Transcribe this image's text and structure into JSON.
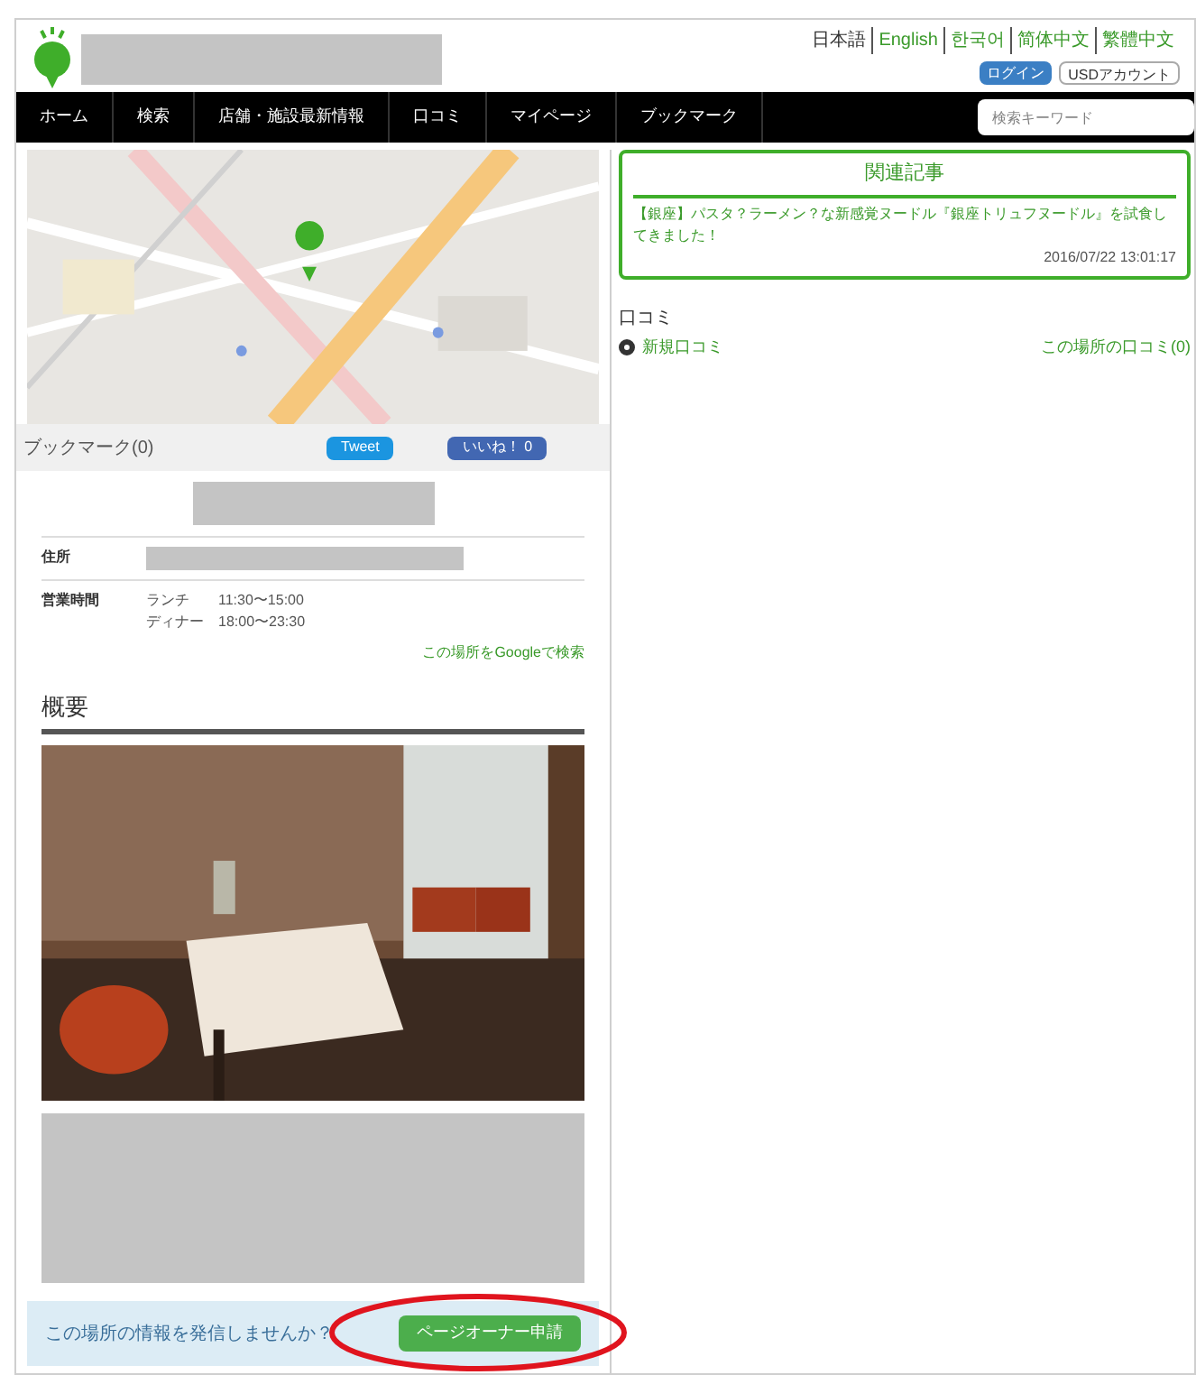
{
  "languages": [
    {
      "label": "日本語",
      "selected": true
    },
    {
      "label": "English",
      "selected": false
    },
    {
      "label": "한국어",
      "selected": false
    },
    {
      "label": "简体中文",
      "selected": false
    },
    {
      "label": "繁體中文",
      "selected": false
    }
  ],
  "account_buttons": [
    {
      "label": "ログイン",
      "kind": "primary"
    },
    {
      "label": "USDアカウント",
      "kind": "plain"
    }
  ],
  "nav": [
    "ホーム",
    "検索",
    "店舗・施設最新情報",
    "口コミ",
    "マイページ",
    "ブックマーク"
  ],
  "search": {
    "placeholder": "検索キーワード"
  },
  "bookmark": "ブックマーク(0)",
  "tweet_button": "Tweet",
  "like_button": "いいね！ 0",
  "info_rows": [
    {
      "label": "住所",
      "kind": "redacted"
    },
    {
      "label": "営業時間",
      "kind": "hours",
      "lines": [
        {
          "name": "ランチ",
          "time": "11:30〜15:00"
        },
        {
          "name": "ディナー",
          "time": "18:00〜23:30"
        }
      ]
    }
  ],
  "google_link": "この場所をGoogleで検索",
  "overview_heading": "概要",
  "owner_prompt": "この場所の情報を発信しませんか？",
  "owner_button": "ページオーナー申請",
  "related": {
    "title": "関連記事",
    "article": "【銀座】パスタ？ラーメン？な新感覚ヌードル『銀座トリュフヌードル』を試食してきました！",
    "date": "2016/07/22 13:01:17"
  },
  "reviews": {
    "heading": "口コミ",
    "new_link": "新規口コミ",
    "count_link": "この場所の口コミ(0)"
  }
}
